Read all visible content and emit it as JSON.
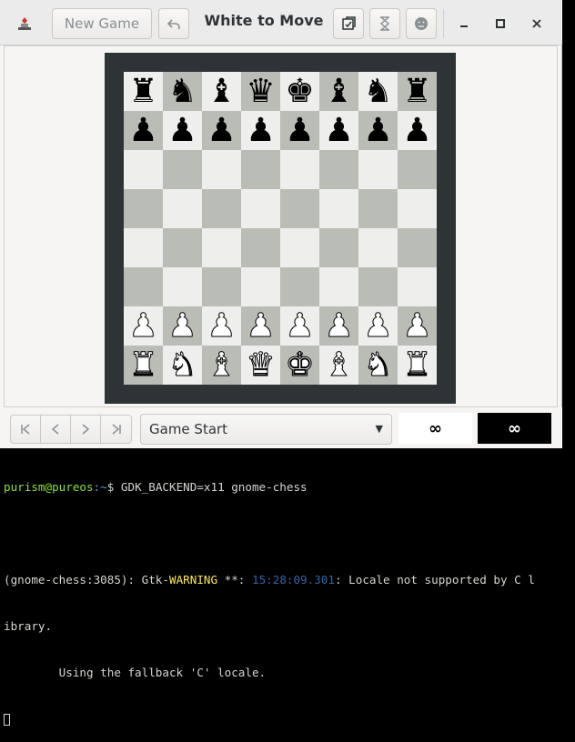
{
  "header": {
    "title": "White to Move",
    "new_game_label": "New Game"
  },
  "board": {
    "rows": [
      [
        "♜",
        "♞",
        "♝",
        "♛",
        "♚",
        "♝",
        "♞",
        "♜"
      ],
      [
        "♟",
        "♟",
        "♟",
        "♟",
        "♟",
        "♟",
        "♟",
        "♟"
      ],
      [
        "",
        "",
        "",
        "",
        "",
        "",
        "",
        ""
      ],
      [
        "",
        "",
        "",
        "",
        "",
        "",
        "",
        ""
      ],
      [
        "",
        "",
        "",
        "",
        "",
        "",
        "",
        ""
      ],
      [
        "",
        "",
        "",
        "",
        "",
        "",
        "",
        ""
      ],
      [
        "♙",
        "♙",
        "♙",
        "♙",
        "♙",
        "♙",
        "♙",
        "♙"
      ],
      [
        "♖",
        "♘",
        "♗",
        "♕",
        "♔",
        "♗",
        "♘",
        "♖"
      ]
    ],
    "colors": {
      "light": "#eeeeec",
      "dark": "#babdb6",
      "frame": "#2e3436"
    }
  },
  "history": {
    "selected": "Game Start"
  },
  "clocks": {
    "white": "∞",
    "black": "∞"
  },
  "terminal": {
    "user_host": "purism@pureos",
    "path": ":~",
    "command": "$ GDK_BACKEND=x11 gnome-chess",
    "warning_prefix": "(gnome-chess:3085): Gtk-",
    "warning_word": "WARNING",
    "warning_stars": " **: ",
    "warning_time": "15:28:09.301",
    "warning_msg": ": Locale not supported by C l",
    "warning_cont": "ibrary.",
    "fallback": "        Using the fallback 'C' locale."
  },
  "icons": {
    "app": "chess-app-icon",
    "undo": "undo-icon",
    "save": "save-icon",
    "pause": "hourglass-icon",
    "resign": "resign-icon",
    "minimize": "minimize-icon",
    "maximize": "maximize-icon",
    "close": "close-icon"
  }
}
